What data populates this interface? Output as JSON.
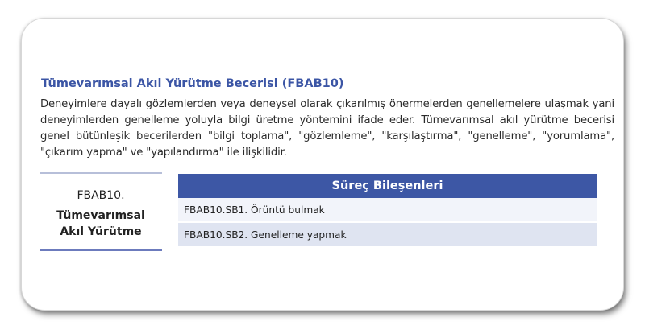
{
  "section": {
    "title": "Tümevarımsal Akıl Yürütme Becerisi (FBAB10)",
    "description": "Deneyimlere dayalı gözlemlerden veya deneysel olarak çıkarılmış önermelerden genellemelere ulaşmak yani deneyimlerden genelleme yoluyla bilgi üretme yöntemini ifade eder. Tümevarımsal akıl yürütme becerisi genel bütünleşik becerilerden \"bilgi toplama\", \"gözlemleme\", \"karşılaştırma\", \"genelleme\", \"yorumlama\", \"çıkarım yapma\" ve \"yapılandırma\" ile ilişkilidir."
  },
  "skill": {
    "code": "FBAB10.",
    "name": "Tümevarımsal Akıl Yürütme"
  },
  "table": {
    "header": "Süreç Bileşenleri",
    "rows": [
      "FBAB10.SB1. Örüntü bulmak",
      "FBAB10.SB2. Genelleme yapmak"
    ]
  },
  "colors": {
    "accent": "#3b55a5",
    "header_bg": "#3d57a5",
    "row_light": "#f2f4fa",
    "row_dark": "#dfe4f1"
  }
}
